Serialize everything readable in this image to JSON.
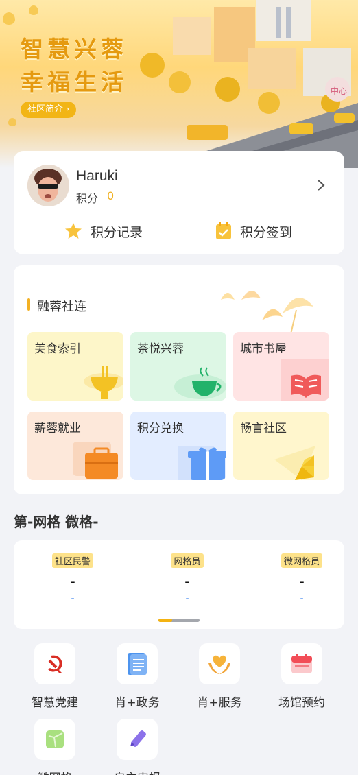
{
  "banner": {
    "title_line1": "智慧兴蓉",
    "title_line2": "幸福生活",
    "intro_button": "社区简介",
    "sign_text": "中心"
  },
  "user": {
    "name": "Haruki",
    "points_label": "积分",
    "points_value": "0",
    "actions": [
      {
        "label": "积分记录",
        "icon": "star-icon"
      },
      {
        "label": "积分签到",
        "icon": "calendar-check-icon"
      }
    ]
  },
  "section": {
    "title": "融蓉社连",
    "tiles": [
      {
        "label": "美食索引",
        "icon": "food-icon"
      },
      {
        "label": "茶悦兴蓉",
        "icon": "tea-cup-icon"
      },
      {
        "label": "城市书屋",
        "icon": "book-icon"
      },
      {
        "label": "薪蓉就业",
        "icon": "briefcase-icon"
      },
      {
        "label": "积分兑换",
        "icon": "gift-icon"
      },
      {
        "label": "畅言社区",
        "icon": "paper-plane-icon"
      }
    ]
  },
  "grid": {
    "title": "第-网格 微格-",
    "columns": [
      {
        "tag": "社区民警",
        "name": "-",
        "phone": "-"
      },
      {
        "tag": "网格员",
        "name": "-",
        "phone": "-"
      },
      {
        "tag": "微网格员",
        "name": "-",
        "phone": "-"
      }
    ]
  },
  "services": [
    {
      "label": "智慧党建",
      "icon": "party-emblem-icon"
    },
    {
      "label": "肖+政务",
      "icon": "document-icon"
    },
    {
      "label": "肖+服务",
      "icon": "heart-hands-icon"
    },
    {
      "label": "场馆预约",
      "icon": "calendar-icon"
    },
    {
      "label": "微网格",
      "icon": "map-icon"
    },
    {
      "label": "自主申报",
      "icon": "pencil-icon"
    }
  ],
  "colors": {
    "accent": "#f3b124",
    "title_gold": "#e59a10",
    "link_blue": "#4a8cf0",
    "background": "#f2f3f7"
  }
}
